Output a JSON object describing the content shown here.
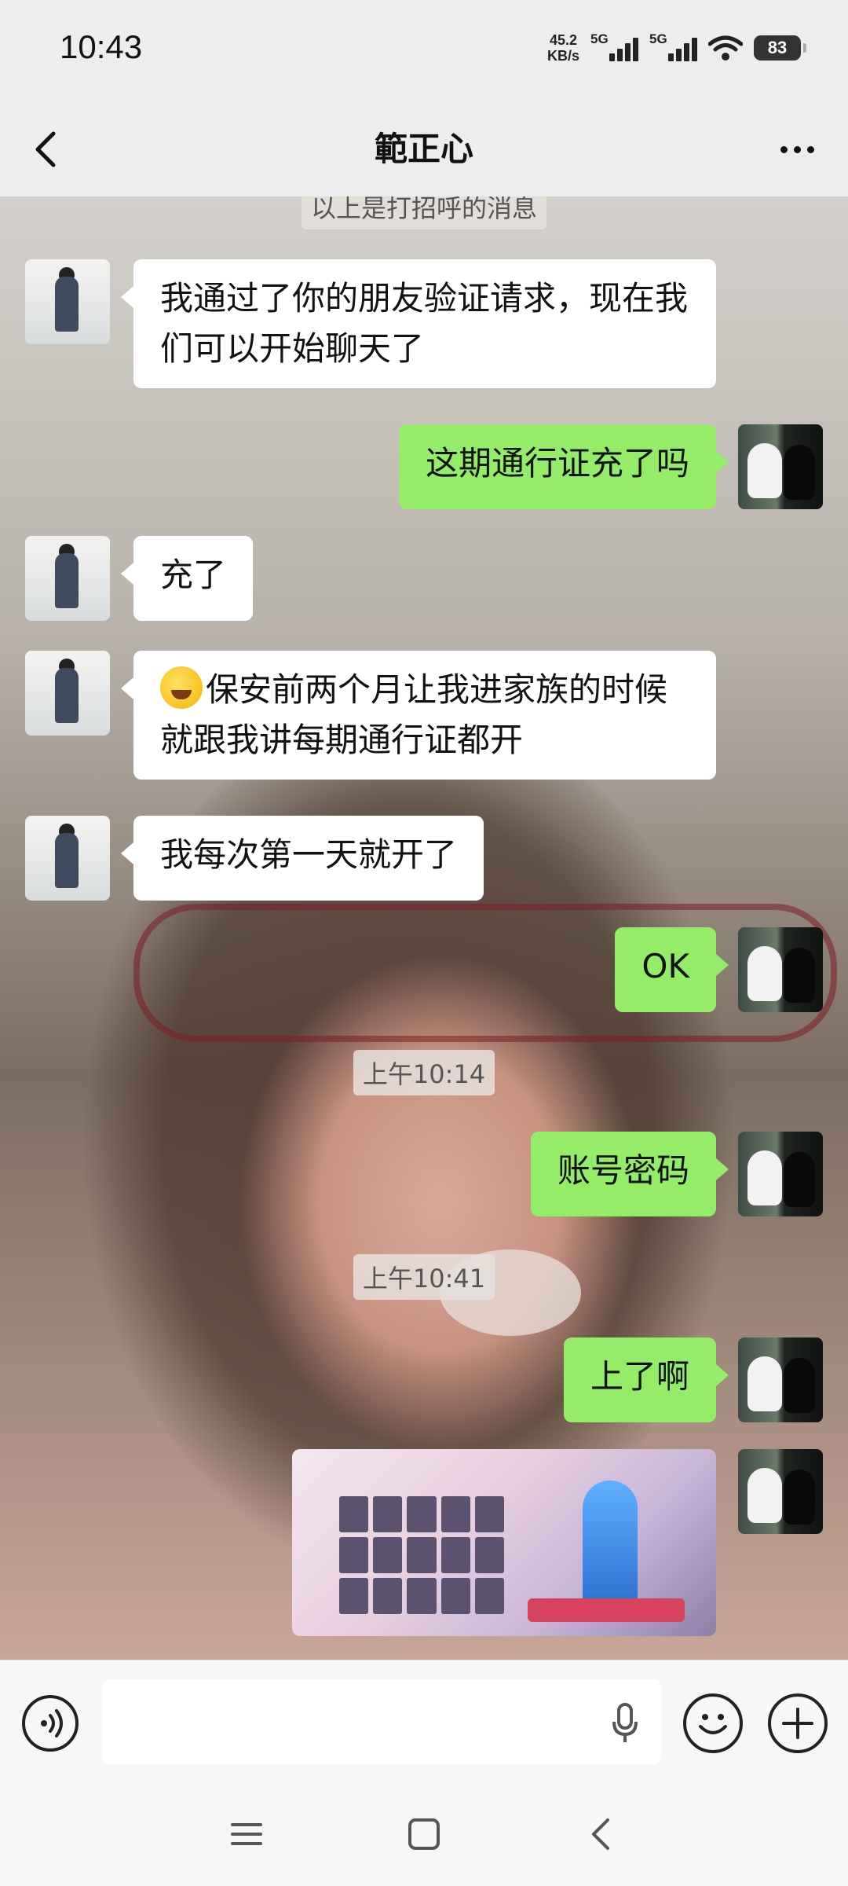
{
  "status_bar": {
    "time": "10:43",
    "net_speed_value": "45.2",
    "net_speed_unit": "KB/s",
    "sim1_label": "5G",
    "sim2_label": "5G",
    "battery": "83"
  },
  "header": {
    "title": "範正心",
    "back_icon": "chevron-left-icon",
    "more_icon": "more-dots-icon"
  },
  "chat": {
    "greeting_notice": "以上是打招呼的消息",
    "messages": [
      {
        "side": "left",
        "text": "我通过了你的朋友验证请求，现在我们可以开始聊天了"
      },
      {
        "side": "right",
        "text": "这期通行证充了吗"
      },
      {
        "side": "left",
        "text": "充了"
      },
      {
        "side": "left",
        "emoji": "laugh-cry-emoji",
        "text": "保安前两个月让我进家族的时候就跟我讲每期通行证都开"
      },
      {
        "side": "left",
        "text": "我每次第一天就开了"
      },
      {
        "side": "right",
        "text": "OK"
      },
      {
        "side": "right",
        "text": "账号密码"
      },
      {
        "side": "right",
        "text": "上了啊"
      },
      {
        "side": "right",
        "type": "image",
        "description": "game screenshot"
      }
    ],
    "timestamps": [
      "上午10:14",
      "上午10:41"
    ]
  },
  "input_bar": {
    "voice_icon": "voice-mode-icon",
    "mic_icon": "microphone-icon",
    "emoji_icon": "smiley-icon",
    "plus_icon": "plus-icon",
    "text_value": ""
  },
  "system_nav": {
    "menu_icon": "menu-icon",
    "home_icon": "home-square-icon",
    "back_icon": "back-triangle-icon"
  },
  "colors": {
    "my_bubble": "#95ec69",
    "their_bubble": "#ffffff",
    "bar_bg": "#ededed"
  }
}
